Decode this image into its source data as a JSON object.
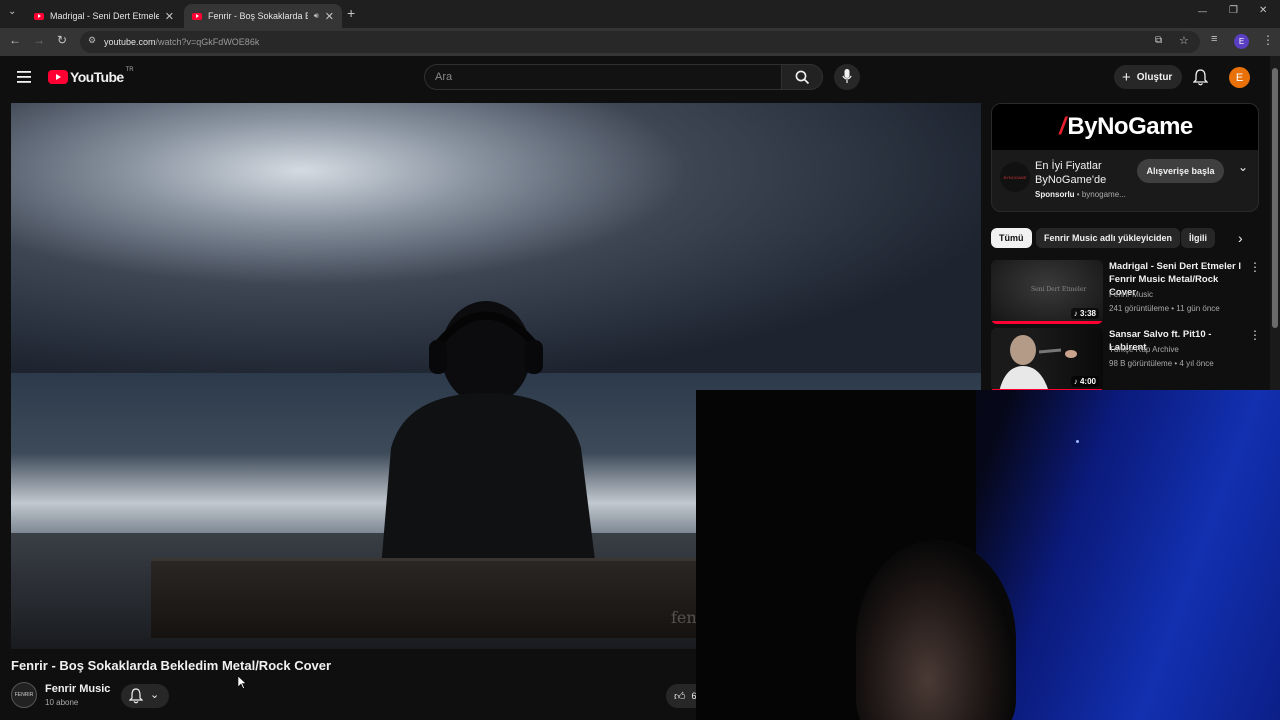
{
  "browser": {
    "tabs": [
      {
        "title": "Madrigal - Seni Dert Etmeler l F",
        "active": false
      },
      {
        "title": "Fenrir - Boş Sokaklarda Bek",
        "active": true
      }
    ],
    "new_tab": "+",
    "url_domain": "youtube.com",
    "url_path": "/watch?v=qGkFdWOE86k",
    "window_controls": [
      "—",
      "❐",
      "✕"
    ]
  },
  "youtube": {
    "logo_text": "YouTube",
    "country": "TR",
    "search_placeholder": "Ara",
    "create_label": "Oluştur",
    "avatar_initial": "E"
  },
  "video": {
    "title": "Fenrir - Boş Sokaklarda Bekledim Metal/Rock Cover",
    "watermark": "fenrir",
    "channel_name": "Fenrir Music",
    "channel_avatar_text": "FENRIR",
    "subscribers": "10 abone",
    "like_count": "6"
  },
  "ad": {
    "brand": "ByNoGame",
    "headline_line1": "En İyi Fiyatlar",
    "headline_line2": "ByNoGame'de",
    "sponsored": "Sponsorlu",
    "domain": "bynogame...",
    "cta": "Alışverişe başla",
    "logo_text": "BYNOGAME"
  },
  "chips": [
    {
      "label": "Tümü",
      "active": true
    },
    {
      "label": "Fenrir Music adlı yükleyiciden",
      "active": false
    },
    {
      "label": "İlgili",
      "active": false
    }
  ],
  "recommendations": [
    {
      "title": "Madrigal - Seni Dert Etmeler l Fenrir Music Metal/Rock Cover",
      "channel": "Fenrir Music",
      "meta": "241 görüntüleme • 11 gün önce",
      "duration": "3:38",
      "watched": 1.0,
      "thumb_text": "Seni Dert Etmeler"
    },
    {
      "title": "Sansar Salvo ft.  Pit10 - Labirent",
      "channel": "Türkçe Rap Archive",
      "meta": "98 B görüntüleme • 4 yıl önce",
      "duration": "4:00",
      "watched": 1.0,
      "thumb_text": ""
    }
  ],
  "colors": {
    "brand_red": "#ff0033",
    "avatar_orange": "#e8710a",
    "background": "#0f0f0f"
  }
}
